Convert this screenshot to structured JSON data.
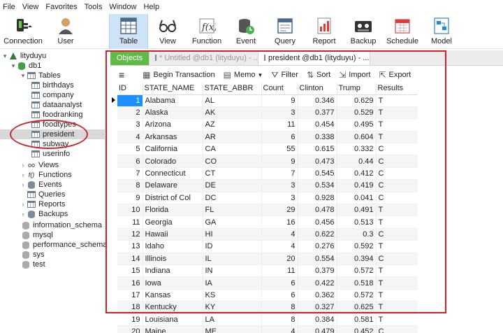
{
  "menu": [
    "File",
    "View",
    "Favorites",
    "Tools",
    "Window",
    "Help"
  ],
  "toolbar": [
    {
      "label": "Connection",
      "icon": "connection-icon"
    },
    {
      "label": "User",
      "icon": "user-icon"
    },
    {
      "label": "Table",
      "icon": "table-icon",
      "active": true
    },
    {
      "label": "View",
      "icon": "view-icon"
    },
    {
      "label": "Function",
      "icon": "function-icon"
    },
    {
      "label": "Event",
      "icon": "event-icon"
    },
    {
      "label": "Query",
      "icon": "query-icon"
    },
    {
      "label": "Report",
      "icon": "report-icon"
    },
    {
      "label": "Backup",
      "icon": "backup-icon"
    },
    {
      "label": "Schedule",
      "icon": "schedule-icon"
    },
    {
      "label": "Model",
      "icon": "model-icon"
    }
  ],
  "tree": {
    "connection": "lityduyu",
    "database": "db1",
    "tables_label": "Tables",
    "tables": [
      "birthdays",
      "company",
      "dataanalyst",
      "foodranking",
      "foodtypes",
      "president",
      "subway",
      "userinfo"
    ],
    "selected_table": "president",
    "folders": [
      "Views",
      "Functions",
      "Events",
      "Queries",
      "Reports",
      "Backups"
    ],
    "other_dbs": [
      "information_schema",
      "mysql",
      "performance_schema",
      "sys",
      "test"
    ]
  },
  "tabs": {
    "objects": "Objects",
    "untitled": "* Untitled @db1 (lityduyu) - ...",
    "president": "president @db1 (lityduyu) - ..."
  },
  "subbar": {
    "begin_transaction": "Begin Transaction",
    "memo": "Memo",
    "filter": "Filter",
    "sort": "Sort",
    "import": "Import",
    "export": "Export"
  },
  "grid": {
    "columns": [
      "ID",
      "STATE_NAME",
      "STATE_ABBR",
      "Count",
      "Clinton",
      "Trump",
      "Results"
    ],
    "rows": [
      [
        "1",
        "Alabama",
        "AL",
        "9",
        "0.346",
        "0.629",
        "T"
      ],
      [
        "2",
        "Alaska",
        "AK",
        "3",
        "0.377",
        "0.529",
        "T"
      ],
      [
        "3",
        "Arizona",
        "AZ",
        "11",
        "0.454",
        "0.495",
        "T"
      ],
      [
        "4",
        "Arkansas",
        "AR",
        "6",
        "0.338",
        "0.604",
        "T"
      ],
      [
        "5",
        "California",
        "CA",
        "55",
        "0.615",
        "0.332",
        "C"
      ],
      [
        "6",
        "Colorado",
        "CO",
        "9",
        "0.473",
        "0.44",
        "C"
      ],
      [
        "7",
        "Connecticut",
        "CT",
        "7",
        "0.545",
        "0.412",
        "C"
      ],
      [
        "8",
        "Delaware",
        "DE",
        "3",
        "0.534",
        "0.419",
        "C"
      ],
      [
        "9",
        "District of Col",
        "DC",
        "3",
        "0.928",
        "0.041",
        "C"
      ],
      [
        "10",
        "Florida",
        "FL",
        "29",
        "0.478",
        "0.491",
        "T"
      ],
      [
        "11",
        "Georgia",
        "GA",
        "16",
        "0.456",
        "0.513",
        "T"
      ],
      [
        "12",
        "Hawaii",
        "HI",
        "4",
        "0.622",
        "0.3",
        "C"
      ],
      [
        "13",
        "Idaho",
        "ID",
        "4",
        "0.276",
        "0.592",
        "T"
      ],
      [
        "14",
        "Illinois",
        "IL",
        "20",
        "0.554",
        "0.394",
        "C"
      ],
      [
        "15",
        "Indiana",
        "IN",
        "11",
        "0.379",
        "0.572",
        "T"
      ],
      [
        "16",
        "Iowa",
        "IA",
        "6",
        "0.422",
        "0.518",
        "T"
      ],
      [
        "17",
        "Kansas",
        "KS",
        "6",
        "0.362",
        "0.572",
        "T"
      ],
      [
        "18",
        "Kentucky",
        "KY",
        "8",
        "0.327",
        "0.625",
        "T"
      ],
      [
        "19",
        "Louisiana",
        "LA",
        "8",
        "0.384",
        "0.581",
        "T"
      ],
      [
        "20",
        "Maine",
        "ME",
        "4",
        "0.479",
        "0.452",
        "C"
      ]
    ]
  },
  "colors": {
    "accent": "#cfe3f7",
    "objects_tab": "#5fba46",
    "annotation": "#d61f26",
    "selected_id": "#1e90ff"
  }
}
